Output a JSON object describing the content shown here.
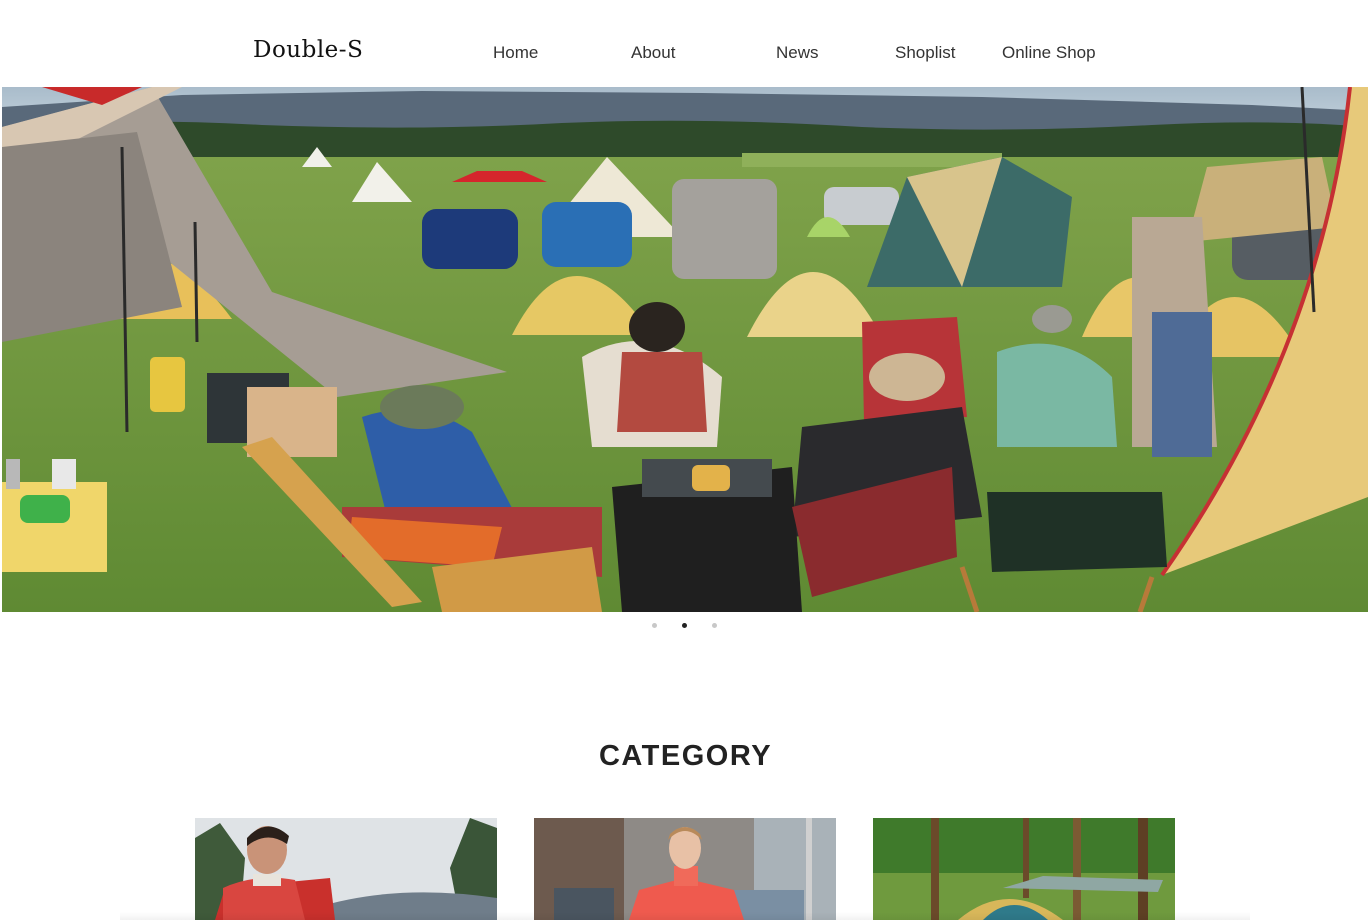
{
  "header": {
    "logo": "Double-S",
    "nav": [
      {
        "label": "Home"
      },
      {
        "label": "About"
      },
      {
        "label": "News"
      },
      {
        "label": "Shoplist"
      },
      {
        "label": "Online Shop"
      }
    ]
  },
  "hero": {
    "image": "camping-campsite-photo",
    "slides_total": 3,
    "active_slide": 2
  },
  "category": {
    "title": "CATEGORY",
    "cards": [
      {
        "image": "man-red-jacket-photo"
      },
      {
        "image": "woman-running-photo"
      },
      {
        "image": "tent-in-forest-photo"
      }
    ]
  },
  "colors": {
    "text": "#222222",
    "nav_text": "#333333",
    "dot_active": "#222222",
    "dot_inactive": "#c8c8c8",
    "background": "#ffffff"
  }
}
